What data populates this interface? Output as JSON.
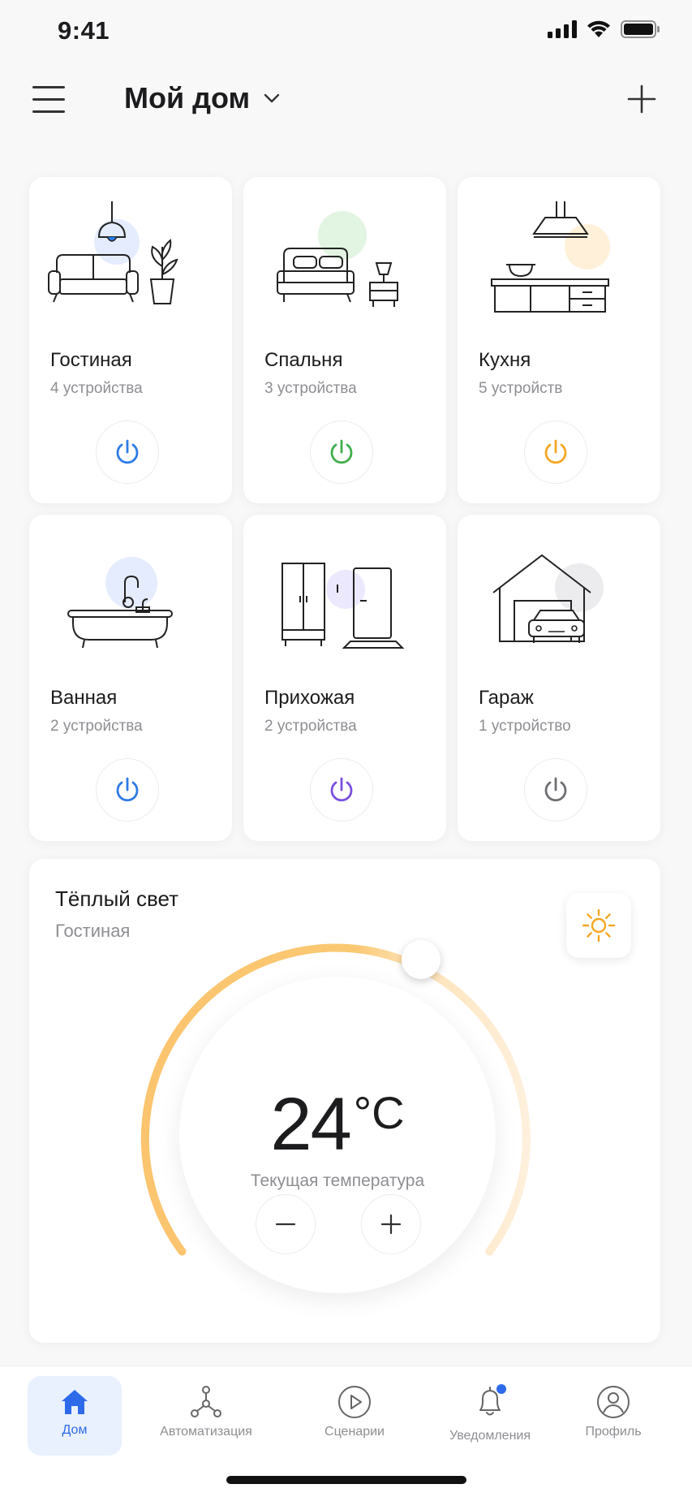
{
  "status": {
    "time": "9:41"
  },
  "header": {
    "title": "Мой дом"
  },
  "rooms": [
    {
      "name": "Гостиная",
      "count": "4 устройства",
      "accent": "#2d7be5"
    },
    {
      "name": "Спальня",
      "count": "3 устройства",
      "accent": "#3fae4c"
    },
    {
      "name": "Кухня",
      "count": "5 устройств",
      "accent": "#f5a623"
    },
    {
      "name": "Ванная",
      "count": "2 устройства",
      "accent": "#2d7be5"
    },
    {
      "name": "Прихожая",
      "count": "2 устройства",
      "accent": "#7a4fe0"
    },
    {
      "name": "Гараж",
      "count": "1 устройство",
      "accent": "#6e6e73"
    }
  ],
  "light": {
    "title": "Тёплый свет",
    "room": "Гостиная",
    "temperature": "24",
    "unit": "°C",
    "label": "Текущая температура"
  },
  "tabs": [
    {
      "label": "Дом",
      "icon": "home-icon",
      "active": true
    },
    {
      "label": "Автоматизация",
      "icon": "nodes-icon"
    },
    {
      "label": "Сценарии",
      "icon": "play-icon"
    },
    {
      "label": "Уведомления",
      "icon": "bell-icon",
      "badge": true
    },
    {
      "label": "Профиль",
      "icon": "profile-icon"
    }
  ],
  "colors": {
    "primary": "#2d6bea",
    "warm": "#f9bd5c",
    "badge": "#2d6bea"
  }
}
